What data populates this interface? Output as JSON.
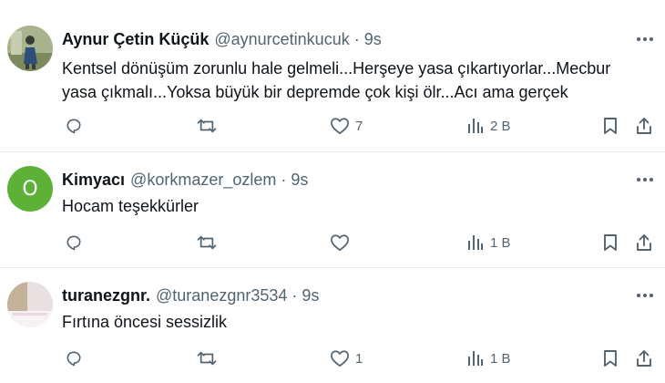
{
  "colors": {
    "text": "#0f1419",
    "muted": "#536471",
    "divider": "#e6e9eb",
    "avatar_green": "#5db137"
  },
  "tweets": [
    {
      "name": "Aynur Çetin Küçük",
      "handle": "@aynurcetinkucuk",
      "dot": "·",
      "time": "9s",
      "avatar": {
        "type": "photo"
      },
      "text_lines": [
        "Kentsel dönüşüm zorunlu hale gelmeli...Herşeye yasa çıkartıyorlar...Mecbur",
        "yasa çıkmalı...Yoksa büyük bir depremde çok kişi ölr...Acı ama gerçek"
      ],
      "likes": "7",
      "views": "2 B"
    },
    {
      "name": "Kimyacı",
      "handle": "@korkmazer_ozlem",
      "dot": "·",
      "time": "9s",
      "avatar": {
        "type": "letter",
        "letter": "O"
      },
      "text_lines": [
        "Hocam teşekkürler"
      ],
      "likes": "",
      "views": "1 B"
    },
    {
      "name": "turanezgnr.",
      "handle": "@turanezgnr3534",
      "dot": "·",
      "time": "9s",
      "avatar": {
        "type": "photo"
      },
      "text_lines": [
        "Fırtına öncesi sessizlik"
      ],
      "likes": "1",
      "views": "1 B"
    }
  ],
  "icons": [
    "reply-icon",
    "retweet-icon",
    "like-icon",
    "views-icon",
    "bookmark-icon",
    "share-icon",
    "more-icon"
  ]
}
